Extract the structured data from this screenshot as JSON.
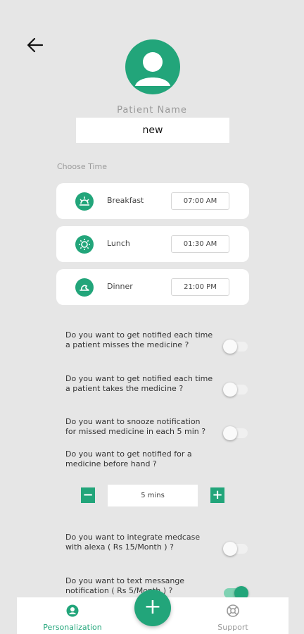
{
  "header": {
    "back_icon": "arrow-left-icon"
  },
  "patient": {
    "label": "Patient Name",
    "value": "new"
  },
  "schedule": {
    "label": "Choose Time",
    "meals": [
      {
        "name": "Breakfast",
        "time": "07:00 AM",
        "icon": "sunrise-icon"
      },
      {
        "name": "Lunch",
        "time": "01:30 AM",
        "icon": "sun-icon"
      },
      {
        "name": "Dinner",
        "time": "21:00 PM",
        "icon": "moon-icon"
      }
    ]
  },
  "settings": {
    "q1": {
      "text": "Do you want to get notified each time a patient misses the medicine ?",
      "enabled": false
    },
    "q2": {
      "text": "Do you want to get notified each time a patient takes the medicine ?",
      "enabled": false
    },
    "q3": {
      "text": "Do you want to snooze notification for missed medicine in each 5 min ?",
      "enabled": false
    },
    "q4": {
      "text": "Do you want to get notified for a medicine before hand ?"
    },
    "stepper": {
      "value": "5 mins",
      "minus": "−",
      "plus": "+"
    },
    "q5": {
      "text": "Do you want to integrate medcase with alexa ( Rs 15/Month ) ?",
      "enabled": false
    },
    "q6": {
      "text": "Do you want to text messange notification ( Rs 5/Month ) ?",
      "enabled": true
    }
  },
  "nav": {
    "personalization": {
      "label": "Personalization",
      "icon": "person-icon"
    },
    "add": {
      "label": "+",
      "icon": "plus-icon"
    },
    "support": {
      "label": "Support",
      "icon": "lifebuoy-icon"
    }
  },
  "colors": {
    "accent": "#22a57a",
    "background": "#e6e6e6",
    "active_nav": "#22a57a",
    "inactive_nav": "#9a9a9a"
  }
}
